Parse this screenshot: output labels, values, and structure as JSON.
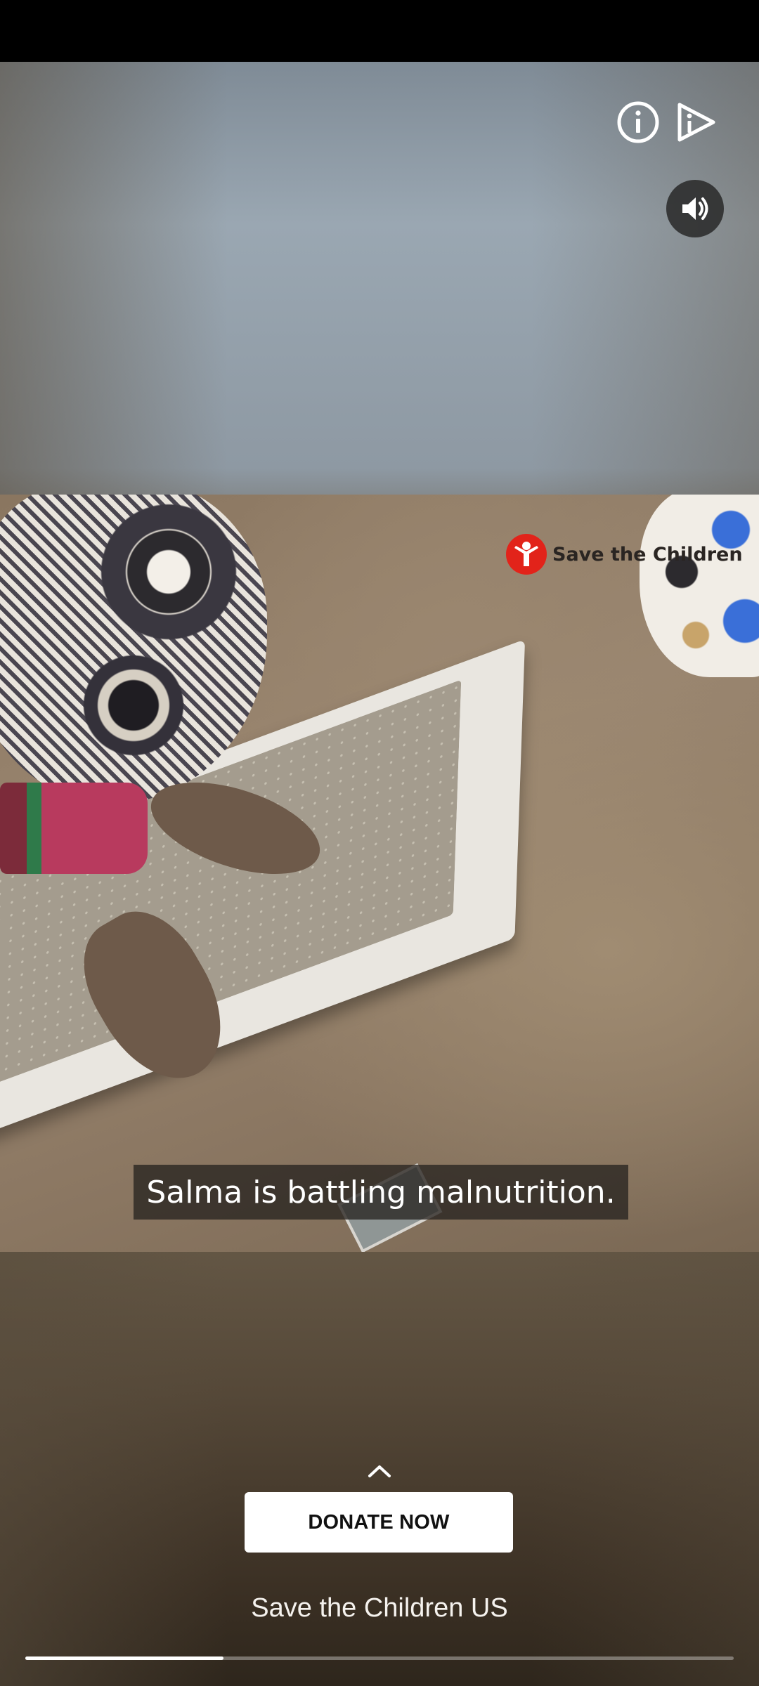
{
  "top_bar": {
    "info_icon": "info-circle-icon",
    "adchoices_icon": "adchoices-icon"
  },
  "sound_button": {
    "icon": "volume-on-icon"
  },
  "video": {
    "brand_logo_text": "Save the Children",
    "caption": "Salma is battling malnutrition."
  },
  "cta": {
    "expand_icon": "chevron-up-icon",
    "button_label": "DONATE NOW"
  },
  "advertiser": {
    "name": "Save the Children US"
  },
  "progress": {
    "fraction": 0.28
  },
  "colors": {
    "brand_red": "#e2231a",
    "button_bg": "#ffffff",
    "progress_fill": "#ffffff"
  }
}
